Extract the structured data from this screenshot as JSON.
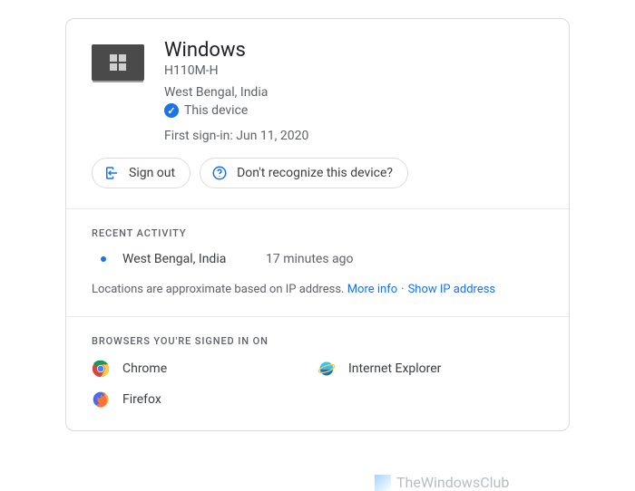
{
  "device": {
    "title": "Windows",
    "model": "H110M-H",
    "location": "West Bengal, India",
    "this_device_label": "This device",
    "first_signin_label": "First sign-in:",
    "first_signin_date": "Jun 11, 2020"
  },
  "actions": {
    "sign_out": "Sign out",
    "not_recognize": "Don't recognize this device?"
  },
  "recent": {
    "heading": "Recent activity",
    "items": [
      {
        "location": "West Bengal, India",
        "time": "17 minutes ago"
      }
    ],
    "footnote": "Locations are approximate based on IP address.",
    "more_info": "More info",
    "show_ip": "Show IP address"
  },
  "browsers": {
    "heading": "Browsers you're signed in on",
    "items": [
      {
        "name": "Chrome"
      },
      {
        "name": "Internet Explorer"
      },
      {
        "name": "Firefox"
      }
    ]
  },
  "watermark": "TheWindowsClub"
}
